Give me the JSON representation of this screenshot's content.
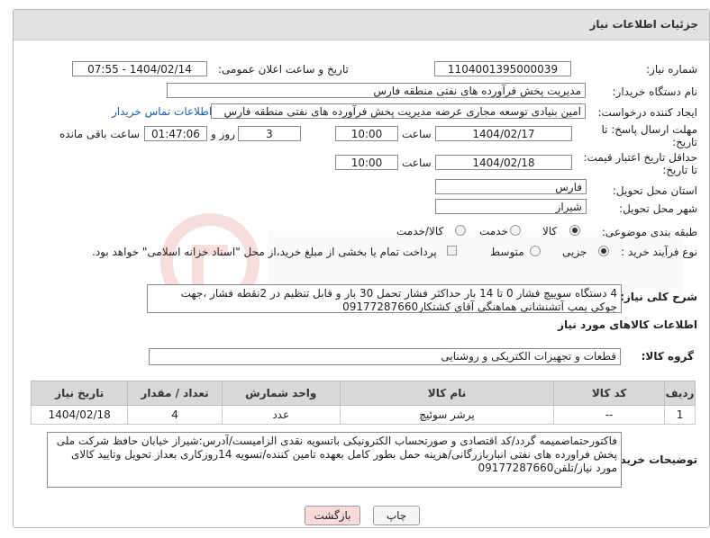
{
  "panel": {
    "title": "جزئیات اطلاعات نیاز"
  },
  "fields": {
    "need_number_label": "شماره نیاز:",
    "need_number": "1104001395000039",
    "announce_label": "تاریخ و ساعت اعلان عمومی:",
    "announce_value": "1404/02/14 - 07:55",
    "buyer_org_label": "نام دستگاه خریدار:",
    "buyer_org": "مدیریت پخش فرآورده های نفتی منطقه فارس",
    "requester_label": "ایجاد کننده درخواست:",
    "requester": "امین بنیادی توسعه مجاری عرضه مدیریت پخش فرآورده های نفتی منطقه فارس",
    "contact_link": "اطلاعات تماس خریدار",
    "deadline_label_1": "مهلت ارسال پاسخ: تا",
    "deadline_label_2": "تاریخ:",
    "deadline_date": "1404/02/17",
    "time_label": "ساعت",
    "deadline_time": "10:00",
    "days_value": "3",
    "days_label": "روز و",
    "remaining_time": "01:47:06",
    "remaining_label": "ساعت باقی مانده",
    "price_valid_label_1": "حداقل تاریخ اعتبار قیمت:",
    "price_valid_label_2": "تا تاریخ:",
    "price_valid_date": "1404/02/18",
    "price_valid_time": "10:00",
    "province_label": "استان محل تحویل:",
    "province": "فارس",
    "city_label": "شهر محل تحویل:",
    "city": "شیراز",
    "category_label": "طبقه بندی موضوعی:",
    "category_options": [
      "کالا",
      "خدمت",
      "کالا/خدمت"
    ],
    "process_label": "نوع فرآیند خرید :",
    "process_options": [
      "جزیی",
      "متوسط"
    ],
    "payment_note": "پرداخت تمام یا بخشی از مبلغ خرید،از محل \"اسناد خزانه اسلامی\" خواهد بود."
  },
  "description": {
    "label": "شرح کلی نیاز:",
    "text": "4 دستگاه سوییچ فشار 0 تا 14 بار حداکثر فشار تحمل 30 بار و قابل تنظیم در 2نقطه فشار ،جهت جوکی پمپ آتشنشانی هماهنگی آقای کشتکار09177287660"
  },
  "goods_section": {
    "title": "اطلاعات کالاهای مورد نیاز",
    "group_label": "گروه کالا:",
    "group_value": "قطعات و تجهیزات الکتریکی و روشنایی"
  },
  "table": {
    "headers": [
      "ردیف",
      "کد کالا",
      "نام کالا",
      "واحد شمارش",
      "تعداد / مقدار",
      "تاریخ نیاز"
    ],
    "rows": [
      [
        "1",
        "--",
        "پرشر سوئیچ",
        "عدد",
        "4",
        "1404/02/18"
      ]
    ]
  },
  "buyer_notes": {
    "label": "توضیحات خریدار:",
    "text": "فاکتورحتماضمیمه گردد/کد اقتصادی و صورتحساب الکترونیکی باتسویه نقدی الزامیست/آدرس:شیراز خیابان حافظ شرکت ملی پخش فراورده های نفتی انباربازرگانی/هزینه حمل بطور کامل بعهده تامین کننده/تسویه 14روزکاری بعداز تحویل وتایید کالای مورد نیاز/تلفن09177287660"
  },
  "buttons": {
    "print": "چاپ",
    "back": "بازگشت"
  },
  "colors": {
    "link": "#1a5fb4",
    "back_button_bg": "#f9d9d9",
    "header_bg": "#e2e2e2"
  }
}
